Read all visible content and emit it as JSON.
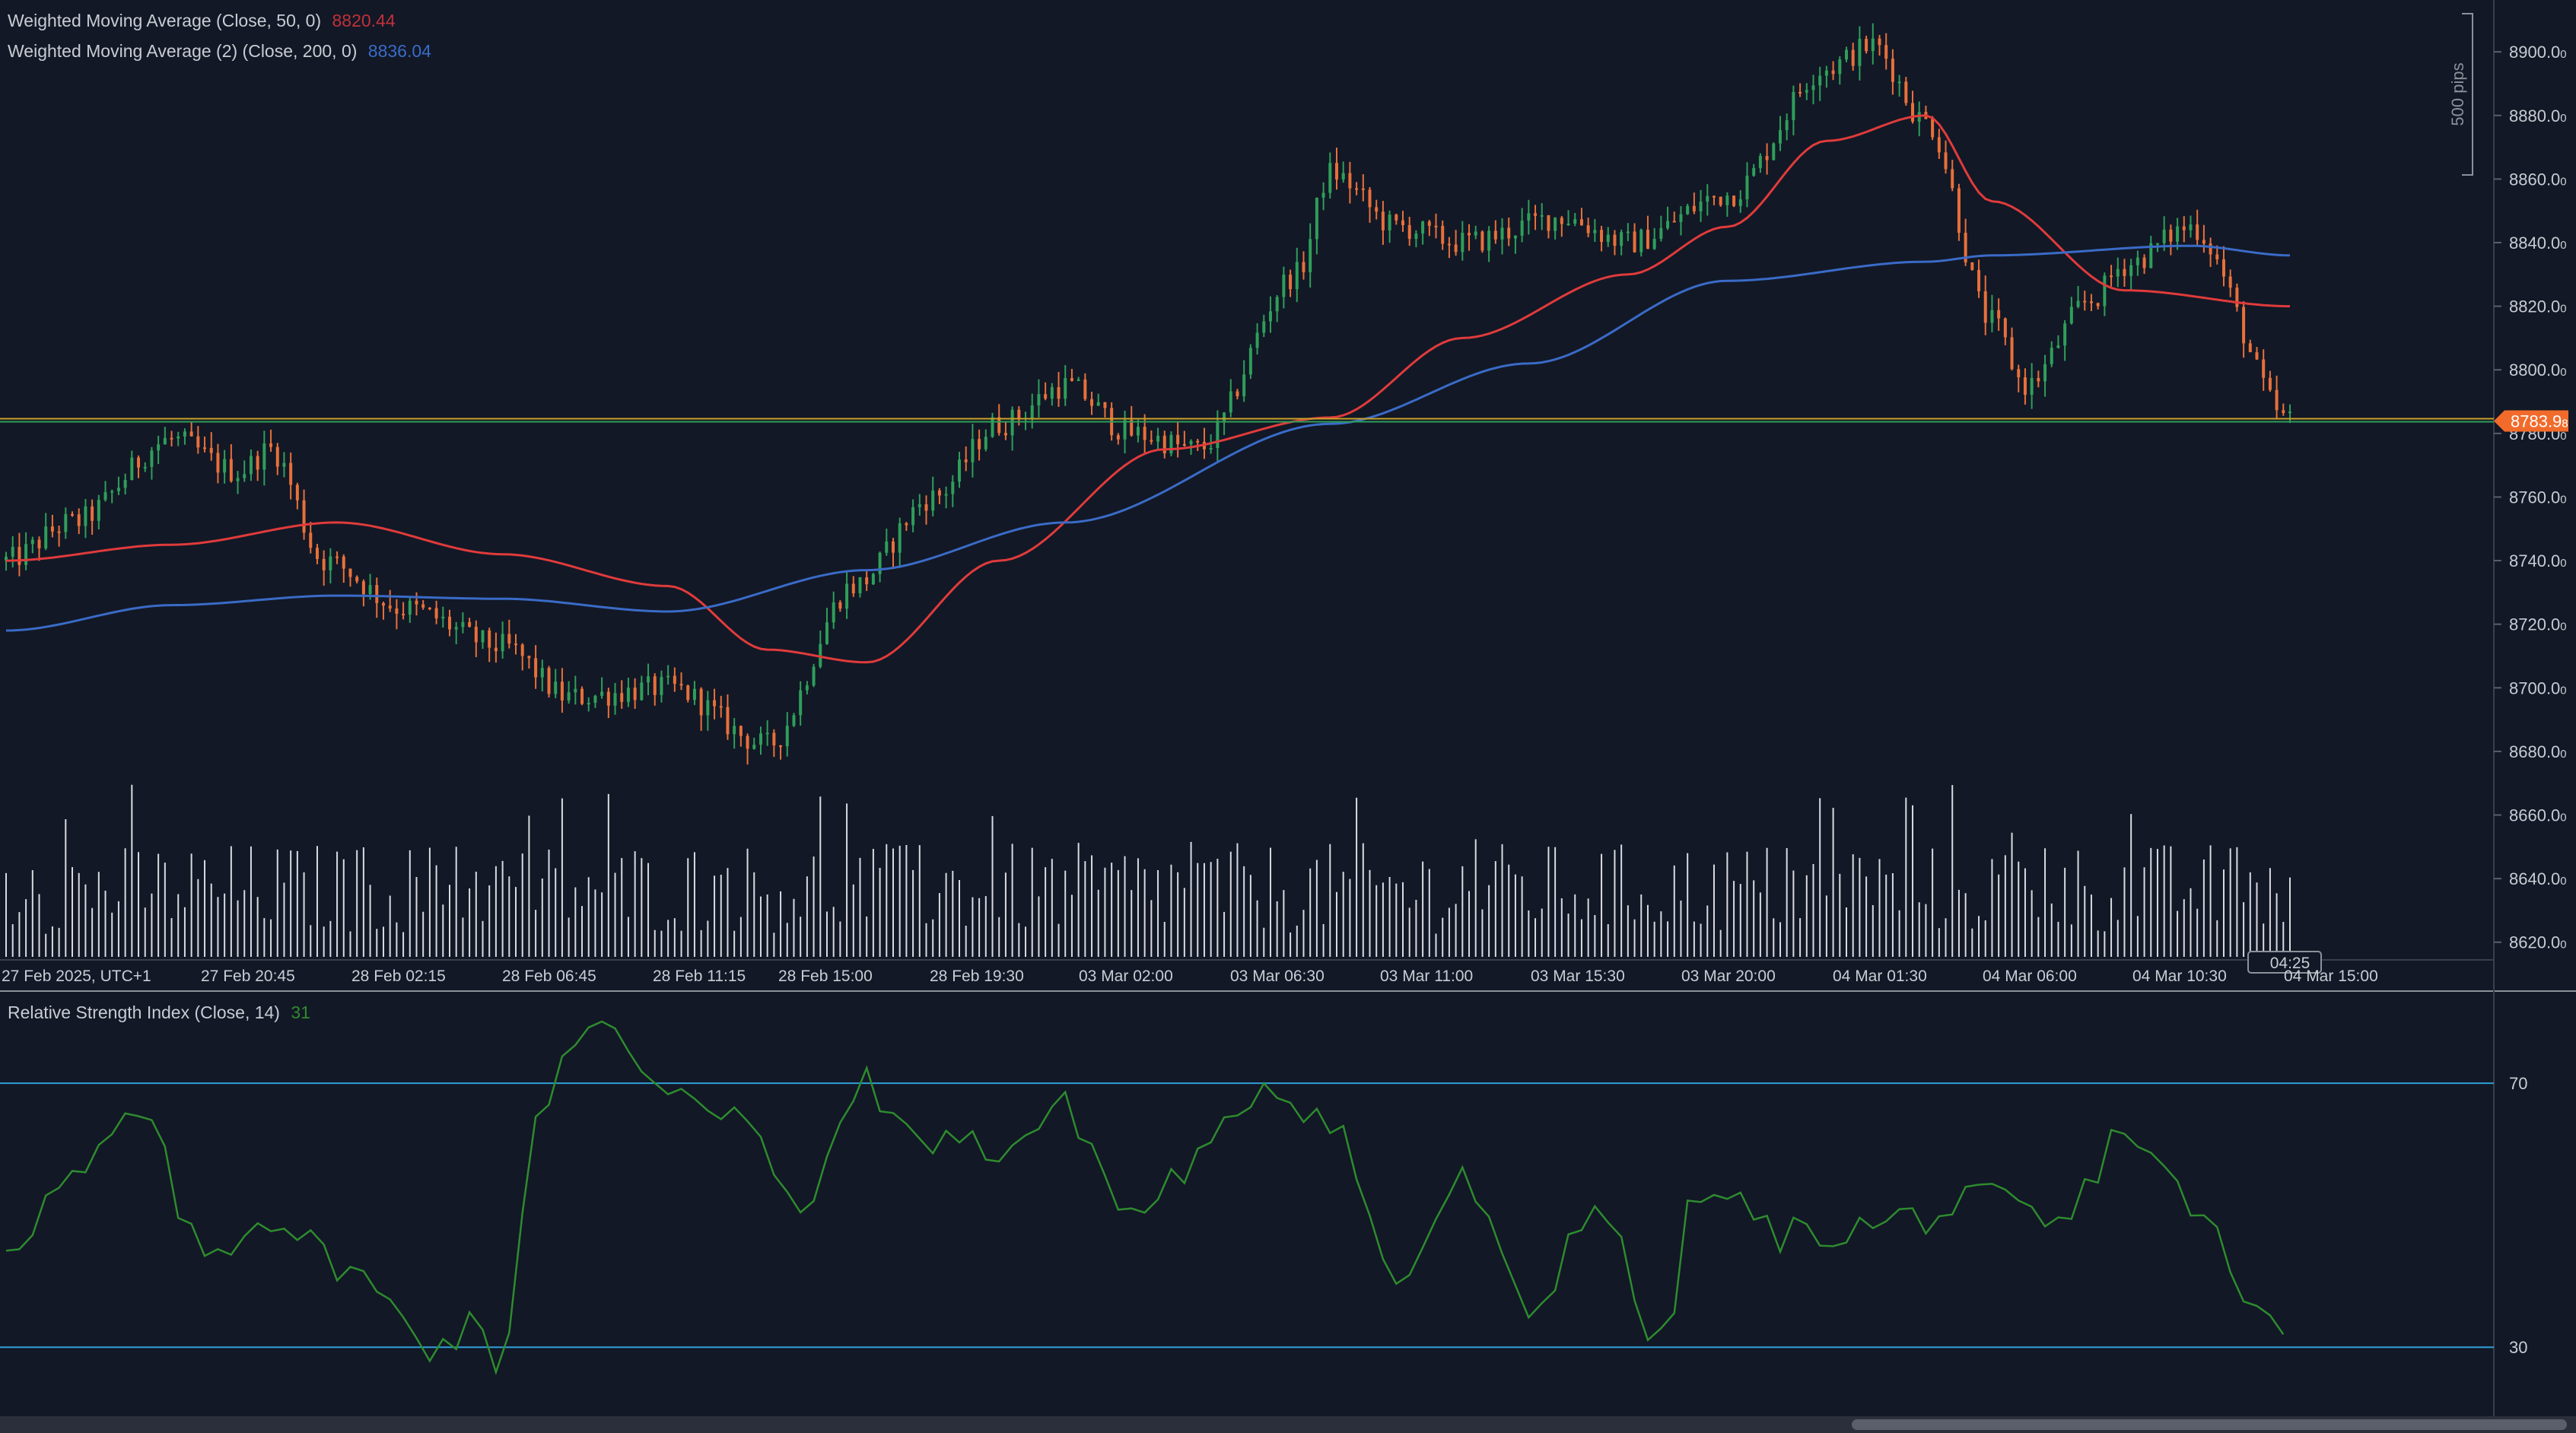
{
  "price_chart": {
    "legend": [
      {
        "label": "Weighted Moving Average (Close, 50, 0)",
        "value": "8820.44",
        "color": "#e03b3b"
      },
      {
        "label": "Weighted Moving Average (2) (Close, 200, 0)",
        "value": "8836.04",
        "color": "#3a6bc7"
      }
    ],
    "current_price_label": "8783.9",
    "current_price_sub": "8",
    "countdown": "04:25",
    "scale_label": "500 pips",
    "y_ticks": [
      "8900.0",
      "8880.0",
      "8860.0",
      "8840.0",
      "8820.0",
      "8800.0",
      "8780.0",
      "8760.0",
      "8740.0",
      "8720.0",
      "8700.0",
      "8680.0",
      "8660.0",
      "8640.0",
      "8620.0"
    ],
    "y_tick_values": [
      8900,
      8880,
      8860,
      8840,
      8820,
      8800,
      8780,
      8760,
      8740,
      8720,
      8700,
      8680,
      8660,
      8640,
      8620
    ],
    "tick_suffix": "0",
    "x_labels": [
      "27 Feb 2025, UTC+1",
      "27 Feb 20:45",
      "28 Feb 02:15",
      "28 Feb 06:45",
      "28 Feb 11:15",
      "28 Feb 15:00",
      "28 Feb 19:30",
      "03 Mar 02:00",
      "03 Mar 06:30",
      "03 Mar 11:00",
      "03 Mar 15:30",
      "03 Mar 20:00",
      "04 Mar 01:30",
      "04 Mar 06:00",
      "04 Mar 10:30",
      "04 Mar 15:00"
    ],
    "colors": {
      "up": "#2f9e5a",
      "down": "#e8703a",
      "volume": "#d9dbe0",
      "price_line_a": "#c9a227",
      "price_line_b": "#2f9e5a",
      "price_badge": "#f26b2b"
    }
  },
  "rsi_chart": {
    "legend": {
      "label": "Relative Strength Index (Close, 14)",
      "value": "31",
      "color": "#2e8b2e"
    },
    "levels": [
      70,
      30
    ],
    "level_labels": [
      "70",
      "30"
    ],
    "colors": {
      "line": "#2e8b2e",
      "level": "#2f9fd8"
    }
  },
  "chart_data": {
    "type": "line",
    "title": "",
    "xlabel": "",
    "ylabel": "",
    "price_ylim": [
      8613,
      8912
    ],
    "rsi_ylim": [
      20,
      82
    ],
    "series": [
      {
        "name": "Weighted Moving Average (Close, 50, 0)",
        "x_index": [
          0,
          25,
          50,
          75,
          100,
          115,
          130,
          150,
          175,
          200,
          220,
          245,
          260,
          275,
          290,
          300,
          320,
          345
        ],
        "values": [
          8740,
          8745,
          8752,
          8742,
          8732,
          8712,
          8708,
          8740,
          8775,
          8785,
          8810,
          8830,
          8845,
          8872,
          8880,
          8853,
          8825,
          8820
        ]
      },
      {
        "name": "Weighted Moving Average (2) (Close, 200, 0)",
        "x_index": [
          0,
          25,
          50,
          75,
          100,
          130,
          160,
          200,
          230,
          260,
          290,
          300,
          330,
          345
        ],
        "values": [
          8718,
          8726,
          8729,
          8728,
          8724,
          8737,
          8752,
          8783,
          8802,
          8828,
          8834,
          8836,
          8839,
          8836
        ]
      },
      {
        "name": "Relative Strength Index (Close, 14)",
        "x_index": [
          0,
          10,
          20,
          30,
          40,
          50,
          60,
          65,
          70,
          75,
          80,
          85,
          90,
          100,
          110,
          120,
          125,
          130,
          135,
          140,
          150,
          160,
          170,
          180,
          190,
          200,
          210,
          220,
          230,
          240,
          250,
          255,
          260,
          265,
          270,
          280,
          290,
          300,
          310,
          320,
          330,
          340,
          345
        ],
        "values": [
          46,
          55,
          65,
          44,
          50,
          43,
          35,
          30,
          33,
          28,
          65,
          75,
          78,
          70,
          66,
          50,
          60,
          72,
          62,
          62,
          60,
          66,
          50,
          58,
          70,
          65,
          40,
          55,
          35,
          52,
          30,
          52,
          53,
          48,
          47,
          48,
          50,
          52,
          48,
          63,
          52,
          35,
          31
        ]
      }
    ],
    "ohlc_summary": {
      "high": 8908,
      "low": 8678,
      "last": 8783.9,
      "bars": 346
    },
    "grid": false,
    "legend_position": "top-left"
  }
}
